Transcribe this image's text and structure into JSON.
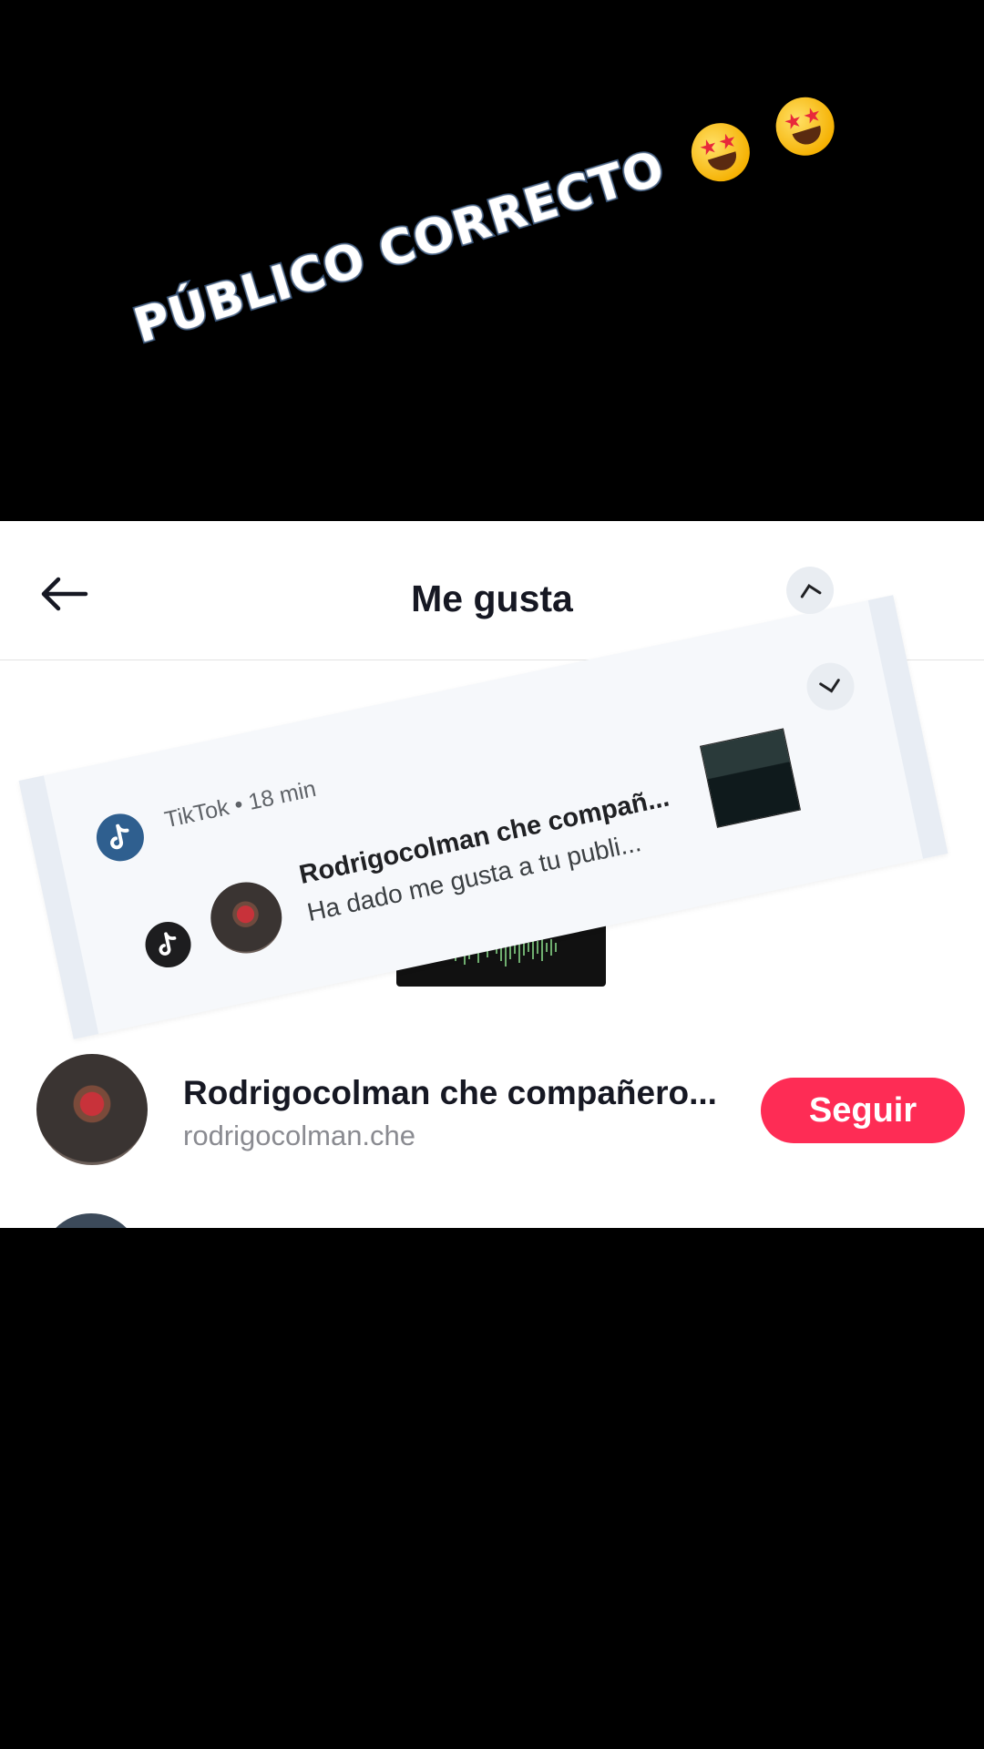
{
  "caption": {
    "text": "PÚBLICO CORRECTO",
    "emojis": [
      "star-struck-emoji",
      "star-struck-emoji"
    ]
  },
  "header": {
    "title": "Me gusta",
    "back_icon": "arrow-left-icon"
  },
  "notification": {
    "app_name": "TikTok",
    "separator": "•",
    "time": "18 min",
    "title": "Rodrigocolman che compañ...",
    "body": "Ha dado me gusta a tu publi...",
    "expand_icon": "chevron-up-icon",
    "collapse_icon": "chevron-down-icon"
  },
  "user": {
    "name": "Rodrigocolman che compañero...",
    "handle": "rodrigocolman.che",
    "follow_label": "Seguir"
  },
  "colors": {
    "accent": "#fe2c55",
    "text": "#161823",
    "muted": "#8a8b91"
  }
}
